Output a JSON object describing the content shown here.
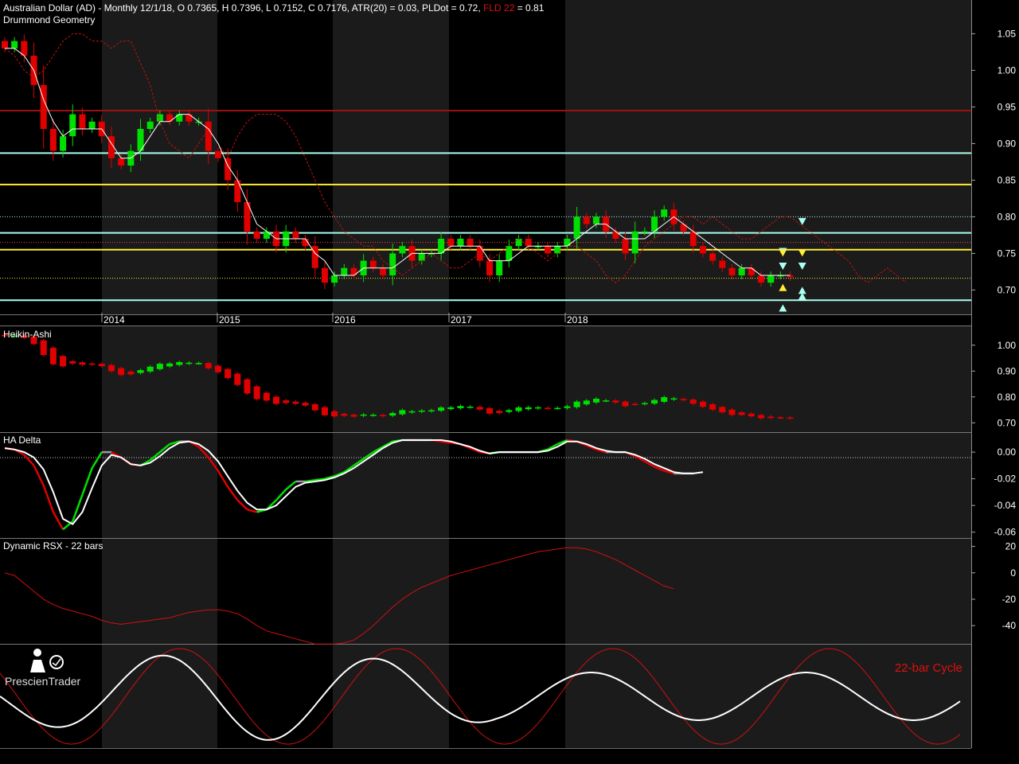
{
  "colors": {
    "background": "#000000",
    "band_alt": "#1b1b1b",
    "up": "#00e000",
    "down": "#e00000",
    "aqua_line": "#aaffee",
    "yellow_line": "#ffee33",
    "dark_red_line": "#9b1010",
    "white": "#ffffff"
  },
  "header": {
    "title_main": "Australian Dollar (AD) - Monthly 12/1/18, O 0.7365, H 0.7396, L 0.7152, C 0.7176, ATR(20) = 0.03, PLDot = 0.72, ",
    "title_fld": "FLD 22",
    "title_tail": " = 0.81"
  },
  "panels": {
    "price_label": "Drummond Geometry",
    "ha_label": "Heikin-Ashi",
    "delta_label": "HA Delta",
    "rsx_label": "Dynamic RSX - 22 bars",
    "cycle_label": "22-bar Cycle"
  },
  "logo": {
    "text": "PrescienTrader",
    "icon": "trader-logo-icon"
  },
  "x_axis": {
    "year_labels": [
      "2014",
      "2015",
      "2016",
      "2017",
      "2018"
    ]
  },
  "chart_data": [
    {
      "type": "candlestick",
      "title": "Drummond Geometry",
      "ylim": [
        0.67,
        1.07
      ],
      "y_ticks": [
        "1.05",
        "1.00",
        "0.95",
        "0.90",
        "0.85",
        "0.80",
        "0.75",
        "0.70"
      ],
      "y_tick_values": [
        1.05,
        1.0,
        0.95,
        0.9,
        0.85,
        0.8,
        0.75,
        0.7
      ],
      "last_bar": {
        "date": "12/1/18",
        "open": 0.7365,
        "high": 0.7396,
        "low": 0.7152,
        "close": 0.7176,
        "atr20": 0.03,
        "pldot": 0.72,
        "fld22": 0.81
      },
      "closes": [
        1.03,
        1.04,
        1.02,
        0.98,
        0.92,
        0.89,
        0.91,
        0.94,
        0.92,
        0.93,
        0.91,
        0.88,
        0.87,
        0.89,
        0.92,
        0.93,
        0.94,
        0.93,
        0.94,
        0.93,
        0.93,
        0.89,
        0.88,
        0.85,
        0.82,
        0.78,
        0.77,
        0.78,
        0.76,
        0.78,
        0.77,
        0.76,
        0.73,
        0.71,
        0.72,
        0.73,
        0.72,
        0.74,
        0.73,
        0.72,
        0.75,
        0.76,
        0.74,
        0.75,
        0.75,
        0.77,
        0.76,
        0.77,
        0.76,
        0.74,
        0.72,
        0.74,
        0.76,
        0.77,
        0.76,
        0.76,
        0.75,
        0.76,
        0.77,
        0.8,
        0.79,
        0.8,
        0.78,
        0.77,
        0.75,
        0.78,
        0.78,
        0.8,
        0.81,
        0.79,
        0.78,
        0.76,
        0.75,
        0.74,
        0.73,
        0.72,
        0.73,
        0.72,
        0.71,
        0.72,
        0.72,
        0.7176
      ],
      "horizontal_levels": [
        {
          "value": 0.945,
          "color": "#9b1010"
        },
        {
          "value": 0.887,
          "color": "#aaffee"
        },
        {
          "value": 0.844,
          "color": "#ffee33"
        },
        {
          "value": 0.778,
          "color": "#aaffee"
        },
        {
          "value": 0.755,
          "color": "#ffee33"
        },
        {
          "value": 0.686,
          "color": "#aaffee"
        }
      ],
      "pldot_values": [
        1.03,
        1.03,
        1.02,
        1.0,
        0.96,
        0.93,
        0.91,
        0.92,
        0.92,
        0.92,
        0.92,
        0.9,
        0.88,
        0.88,
        0.89,
        0.91,
        0.93,
        0.93,
        0.94,
        0.94,
        0.93,
        0.92,
        0.9,
        0.87,
        0.85,
        0.82,
        0.79,
        0.78,
        0.77,
        0.77,
        0.77,
        0.77,
        0.75,
        0.74,
        0.72,
        0.72,
        0.72,
        0.73,
        0.73,
        0.73,
        0.73,
        0.74,
        0.75,
        0.75,
        0.75,
        0.75,
        0.76,
        0.76,
        0.76,
        0.76,
        0.74,
        0.74,
        0.74,
        0.75,
        0.76,
        0.76,
        0.76,
        0.76,
        0.76,
        0.77,
        0.78,
        0.79,
        0.79,
        0.78,
        0.77,
        0.77,
        0.77,
        0.78,
        0.79,
        0.8,
        0.79,
        0.78,
        0.77,
        0.76,
        0.75,
        0.74,
        0.73,
        0.73,
        0.72,
        0.72,
        0.72,
        0.72
      ],
      "fld_values": [
        1.03,
        1.02,
        1.0,
        0.99,
        1.0,
        1.02,
        1.04,
        1.05,
        1.05,
        1.04,
        1.04,
        1.03,
        1.04,
        1.04,
        1.01,
        0.98,
        0.93,
        0.9,
        0.89,
        0.88,
        0.9,
        0.92,
        0.9,
        0.88,
        0.91,
        0.93,
        0.94,
        0.94,
        0.94,
        0.93,
        0.91,
        0.88,
        0.85,
        0.82,
        0.8,
        0.78,
        0.77,
        0.76,
        0.76,
        0.74,
        0.73,
        0.72,
        0.73,
        0.74,
        0.75,
        0.74,
        0.73,
        0.73,
        0.74,
        0.75,
        0.74,
        0.75,
        0.76,
        0.77,
        0.76,
        0.75,
        0.74,
        0.75,
        0.76,
        0.76,
        0.75,
        0.74,
        0.72,
        0.71,
        0.72,
        0.74,
        0.76,
        0.77,
        0.78,
        0.79,
        0.8,
        0.8,
        0.79,
        0.8,
        0.79,
        0.78,
        0.77,
        0.77,
        0.78,
        0.79,
        0.8,
        0.8,
        0.79,
        0.78,
        0.77,
        0.76,
        0.75,
        0.74,
        0.72,
        0.71,
        0.72,
        0.73,
        0.72,
        0.71
      ],
      "markers": [
        {
          "bar": 82,
          "value": 0.793,
          "shape": "down",
          "color": "#aaffee"
        },
        {
          "bar": 80,
          "value": 0.752,
          "shape": "down",
          "color": "#aaffee"
        },
        {
          "bar": 80,
          "value": 0.75,
          "shape": "down",
          "color": "#ffee33"
        },
        {
          "bar": 82,
          "value": 0.75,
          "shape": "down",
          "color": "#ffee33"
        },
        {
          "bar": 80,
          "value": 0.732,
          "shape": "down",
          "color": "#aaffee"
        },
        {
          "bar": 82,
          "value": 0.732,
          "shape": "down",
          "color": "#aaffee"
        },
        {
          "bar": 80,
          "value": 0.704,
          "shape": "up",
          "color": "#ffee33"
        },
        {
          "bar": 82,
          "value": 0.7,
          "shape": "up",
          "color": "#aaffee"
        },
        {
          "bar": 82,
          "value": 0.692,
          "shape": "up",
          "color": "#aaffee"
        },
        {
          "bar": 80,
          "value": 0.676,
          "shape": "up",
          "color": "#aaffee"
        }
      ]
    },
    {
      "type": "candlestick",
      "title": "Heikin-Ashi",
      "ylim": [
        0.67,
        1.07
      ],
      "y_ticks": [
        "1.00",
        "0.90",
        "0.80",
        "0.70"
      ],
      "y_tick_values": [
        1.0,
        0.9,
        0.8,
        0.7
      ]
    },
    {
      "type": "line",
      "title": "HA Delta",
      "ylim": [
        -0.062,
        0.012
      ],
      "y_ticks": [
        "0.00",
        "-0.02",
        "-0.04",
        "-0.06"
      ],
      "y_tick_values": [
        0.0,
        -0.02,
        -0.04,
        -0.06
      ],
      "series": [
        {
          "values": [
            0.003,
            0.002,
            -0.002,
            -0.01,
            -0.025,
            -0.045,
            -0.058,
            -0.052,
            -0.032,
            -0.012,
            0.0,
            0.0,
            -0.004,
            -0.009,
            -0.01,
            -0.006,
            0.0,
            0.006,
            0.008,
            0.008,
            0.004,
            -0.004,
            -0.014,
            -0.026,
            -0.036,
            -0.043,
            -0.045,
            -0.043,
            -0.036,
            -0.028,
            -0.022,
            -0.022,
            -0.021,
            -0.02,
            -0.018,
            -0.015,
            -0.01,
            -0.005,
            0.0,
            0.004,
            0.008,
            0.009,
            0.009,
            0.009,
            0.009,
            0.008,
            0.007,
            0.006,
            0.003,
            0.0,
            -0.001,
            0.0,
            0.0,
            0.0,
            0.0,
            0.0,
            0.002,
            0.006,
            0.009,
            0.008,
            0.005,
            0.002,
            0.0,
            0.0,
            0.0,
            -0.003,
            -0.007,
            -0.011,
            -0.014,
            -0.016,
            -0.016,
            -0.016
          ]
        },
        {
          "values": [
            0.003,
            0.002,
            0.0,
            -0.004,
            -0.013,
            -0.03,
            -0.05,
            -0.054,
            -0.045,
            -0.027,
            -0.01,
            -0.002,
            -0.004,
            -0.009,
            -0.01,
            -0.008,
            -0.003,
            0.003,
            0.007,
            0.008,
            0.006,
            0.001,
            -0.007,
            -0.018,
            -0.029,
            -0.038,
            -0.043,
            -0.043,
            -0.04,
            -0.033,
            -0.026,
            -0.023,
            -0.022,
            -0.021,
            -0.019,
            -0.016,
            -0.012,
            -0.007,
            -0.002,
            0.003,
            0.007,
            0.009,
            0.009,
            0.009,
            0.009,
            0.009,
            0.008,
            0.006,
            0.004,
            0.001,
            -0.001,
            0.0,
            0.0,
            0.0,
            0.0,
            0.0,
            0.001,
            0.004,
            0.008,
            0.008,
            0.006,
            0.003,
            0.001,
            0.0,
            0.0,
            -0.002,
            -0.005,
            -0.009,
            -0.012,
            -0.015,
            -0.016,
            -0.016,
            -0.015
          ]
        }
      ]
    },
    {
      "type": "line",
      "title": "Dynamic RSX - 22 bars",
      "ylim": [
        -52,
        24
      ],
      "y_ticks": [
        "20",
        "0",
        "-20",
        "-40"
      ],
      "y_tick_values": [
        20,
        0,
        -20,
        -40
      ],
      "series": [
        {
          "values": [
            0,
            -2,
            -8,
            -14,
            -20,
            -24,
            -27,
            -29,
            -31,
            -33,
            -36,
            -38,
            -39,
            -38,
            -37,
            -36,
            -35,
            -34,
            -32,
            -30,
            -29,
            -28,
            -28,
            -29,
            -31,
            -35,
            -40,
            -44,
            -46,
            -48,
            -50,
            -52,
            -54,
            -54,
            -54,
            -53,
            -51,
            -46,
            -40,
            -33,
            -26,
            -20,
            -15,
            -11,
            -8,
            -5,
            -2,
            0,
            2,
            4,
            6,
            8,
            10,
            12,
            14,
            16,
            17,
            18,
            19,
            19,
            18,
            16,
            13,
            10,
            6,
            2,
            -2,
            -6,
            -10,
            -12
          ]
        }
      ]
    },
    {
      "type": "line",
      "title": "22-bar Cycle",
      "series": [
        {
          "name": "22-bar Cycle",
          "period_px": 270,
          "phase": 0.5
        },
        {
          "period_px": 272,
          "phase": 0.42
        }
      ]
    }
  ]
}
